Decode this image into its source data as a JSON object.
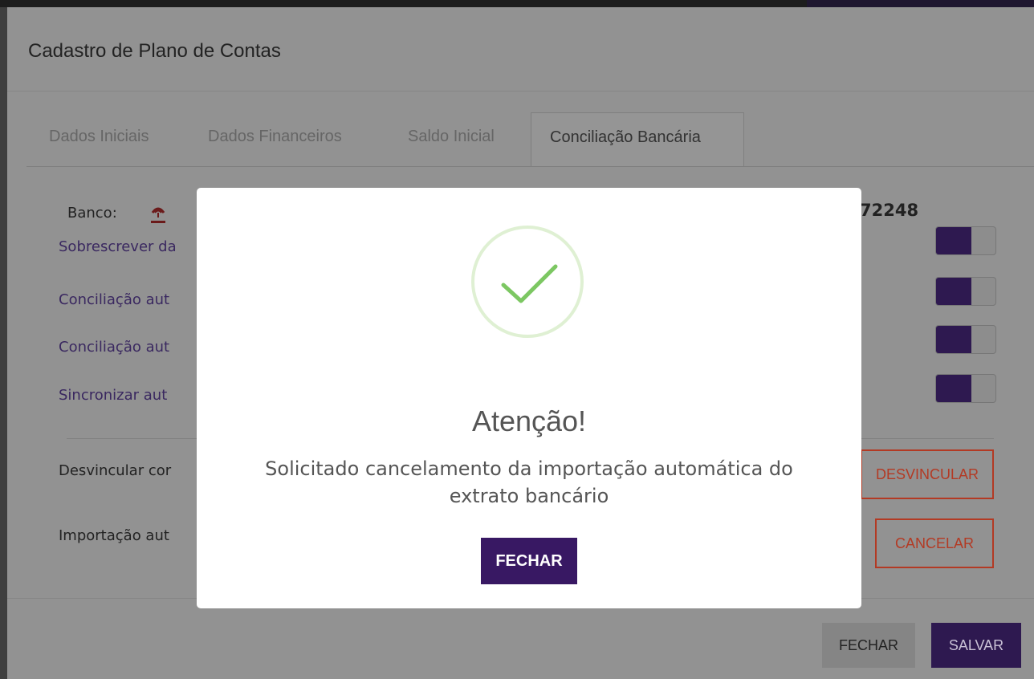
{
  "dialog": {
    "title": "Cadastro de Plano de Contas",
    "tabs": [
      {
        "label": "Dados Iniciais"
      },
      {
        "label": "Dados Financeiros"
      },
      {
        "label": "Saldo Inicial"
      },
      {
        "label": "Conciliação Bancária"
      }
    ],
    "banco_label": "Banco:",
    "bank_number_partial": "72248",
    "options": [
      {
        "label": "Sobrescrever da",
        "enabled": true
      },
      {
        "label": "Conciliação aut",
        "enabled": true
      },
      {
        "label": "Conciliação aut",
        "enabled": true
      },
      {
        "label": "Sincronizar aut",
        "enabled": true
      }
    ],
    "desvincular_label": "Desvincular cor",
    "desvincular_button": "DESVINCULAR",
    "importacao_label": "Importação aut",
    "cancelar_button": "CANCELAR",
    "footer": {
      "close_label": "FECHAR",
      "save_label": "SALVAR"
    }
  },
  "modal": {
    "title": "Atenção!",
    "message": "Solicitado cancelamento da importação automática do extrato bancário",
    "button_label": "FECHAR",
    "icon": "success-check-icon",
    "accent_color": "#381863"
  },
  "colors": {
    "brand_purple": "#381863",
    "danger_red": "#b33a24",
    "success_green": "#7cc762"
  }
}
